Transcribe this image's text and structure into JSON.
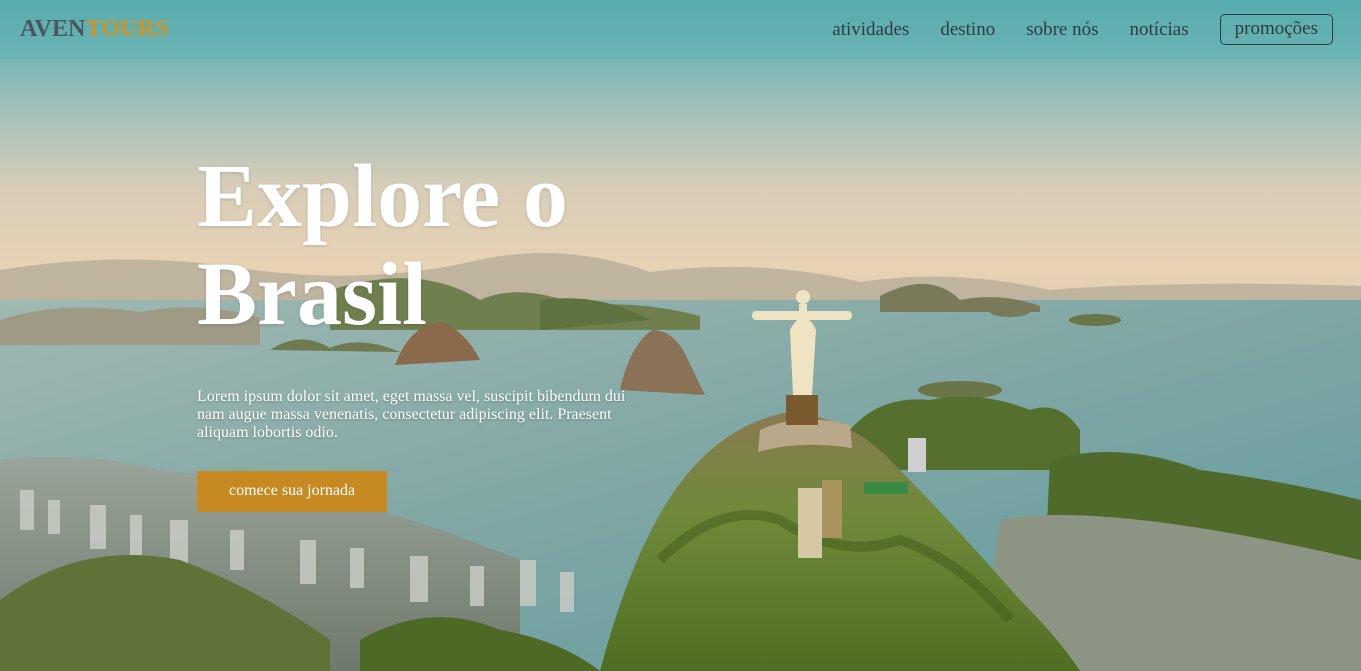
{
  "brand": {
    "name_part1": "AVEN",
    "name_part2": "TOURS",
    "color_part1": "#4c5560",
    "color_part2": "#d09326"
  },
  "nav": {
    "items": [
      {
        "label": "atividades"
      },
      {
        "label": "destino"
      },
      {
        "label": "sobre nós"
      },
      {
        "label": "notícias"
      }
    ],
    "promo_label": "promoções"
  },
  "hero": {
    "title_line1": "Explore o",
    "title_line2": "Brasil",
    "description": "Lorem ipsum dolor sit amet, eget massa vel, suscipit bibendum dui nam augue massa venenatis, consectetur adipiscing elit. Praesent aliquam lobortis odio.",
    "cta_label": "comece sua jornada",
    "cta_color": "#c78a22",
    "background_image": "aerial view of Rio de Janeiro with Christ the Redeemer statue, Sugarloaf Mountain and Guanabara Bay"
  }
}
